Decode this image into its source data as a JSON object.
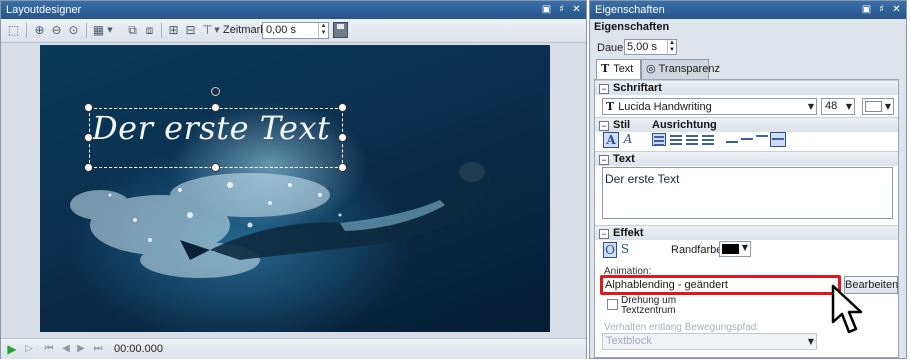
{
  "layout_designer": {
    "title": "Layoutdesigner",
    "toolbar": {
      "zeitmarke_label": "Zeitmarke:",
      "zeitmarke_value": "0,00 s"
    },
    "canvas_text": "Der erste Text",
    "status": {
      "time": "00:00.000"
    }
  },
  "properties": {
    "window_title": "Eigenschaften",
    "header": "Eigenschaften",
    "dauer_label": "Dauer:",
    "dauer_value": "5,00 s",
    "tabs": [
      {
        "label": "Text",
        "icon": "text-T-icon",
        "active": true
      },
      {
        "label": "Transparenz",
        "icon": "transparency-icon",
        "active": false
      }
    ],
    "schriftart": {
      "section": "Schriftart",
      "font": "Lucida Handwriting",
      "size": "48",
      "color": "#ffffff"
    },
    "stil": {
      "section": "Stil",
      "ausrichtung": "Ausrichtung"
    },
    "text": {
      "section": "Text",
      "value": "Der erste Text"
    },
    "effekt": {
      "section": "Effekt",
      "randfarbe_label": "Randfarbe:",
      "randfarbe_color": "#000000",
      "animation_label": "Animation:",
      "animation_value": "Alphablending - geändert",
      "bearbeiten": "Bearbeiten",
      "drehung_label_1": "Drehung um",
      "drehung_label_2": "Textzentrum",
      "pfad_label": "Verhalten entlang Bewegungspfad:",
      "pfad_value": "Textblock"
    }
  },
  "colors": {
    "title_bar": "#2f609a",
    "highlight": "#e3161d"
  }
}
